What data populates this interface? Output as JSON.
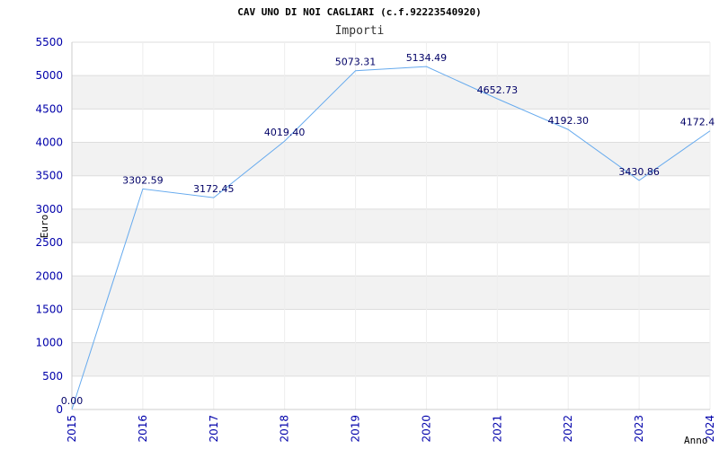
{
  "chart_data": {
    "type": "line",
    "title": "CAV UNO DI NOI CAGLIARI (c.f.92223540920)",
    "subtitle": "Importi",
    "xlabel": "Anno",
    "ylabel": "Euro",
    "categories": [
      "2015",
      "2016",
      "2017",
      "2018",
      "2019",
      "2020",
      "2021",
      "2022",
      "2023",
      "2024"
    ],
    "series": [
      {
        "values": [
          0.0,
          3302.59,
          3172.45,
          4019.4,
          5073.31,
          5134.49,
          4652.73,
          4192.3,
          3430.86,
          4172.4
        ],
        "labels": [
          "0.00",
          "3302.59",
          "3172.45",
          "4019.40",
          "5073.31",
          "5134.49",
          "4652.73",
          "4192.30",
          "3430.86",
          "4172.4"
        ]
      }
    ],
    "ylim": [
      0,
      5500
    ],
    "yticks": [
      0,
      500,
      1000,
      1500,
      2000,
      2500,
      3000,
      3500,
      4000,
      4500,
      5000,
      5500
    ],
    "grid": true,
    "colors": {
      "line": "#66aaee",
      "band": "#f2f2f2",
      "grid": "#dddddd",
      "tick_text": "#0000aa",
      "label_text": "#000066"
    }
  }
}
